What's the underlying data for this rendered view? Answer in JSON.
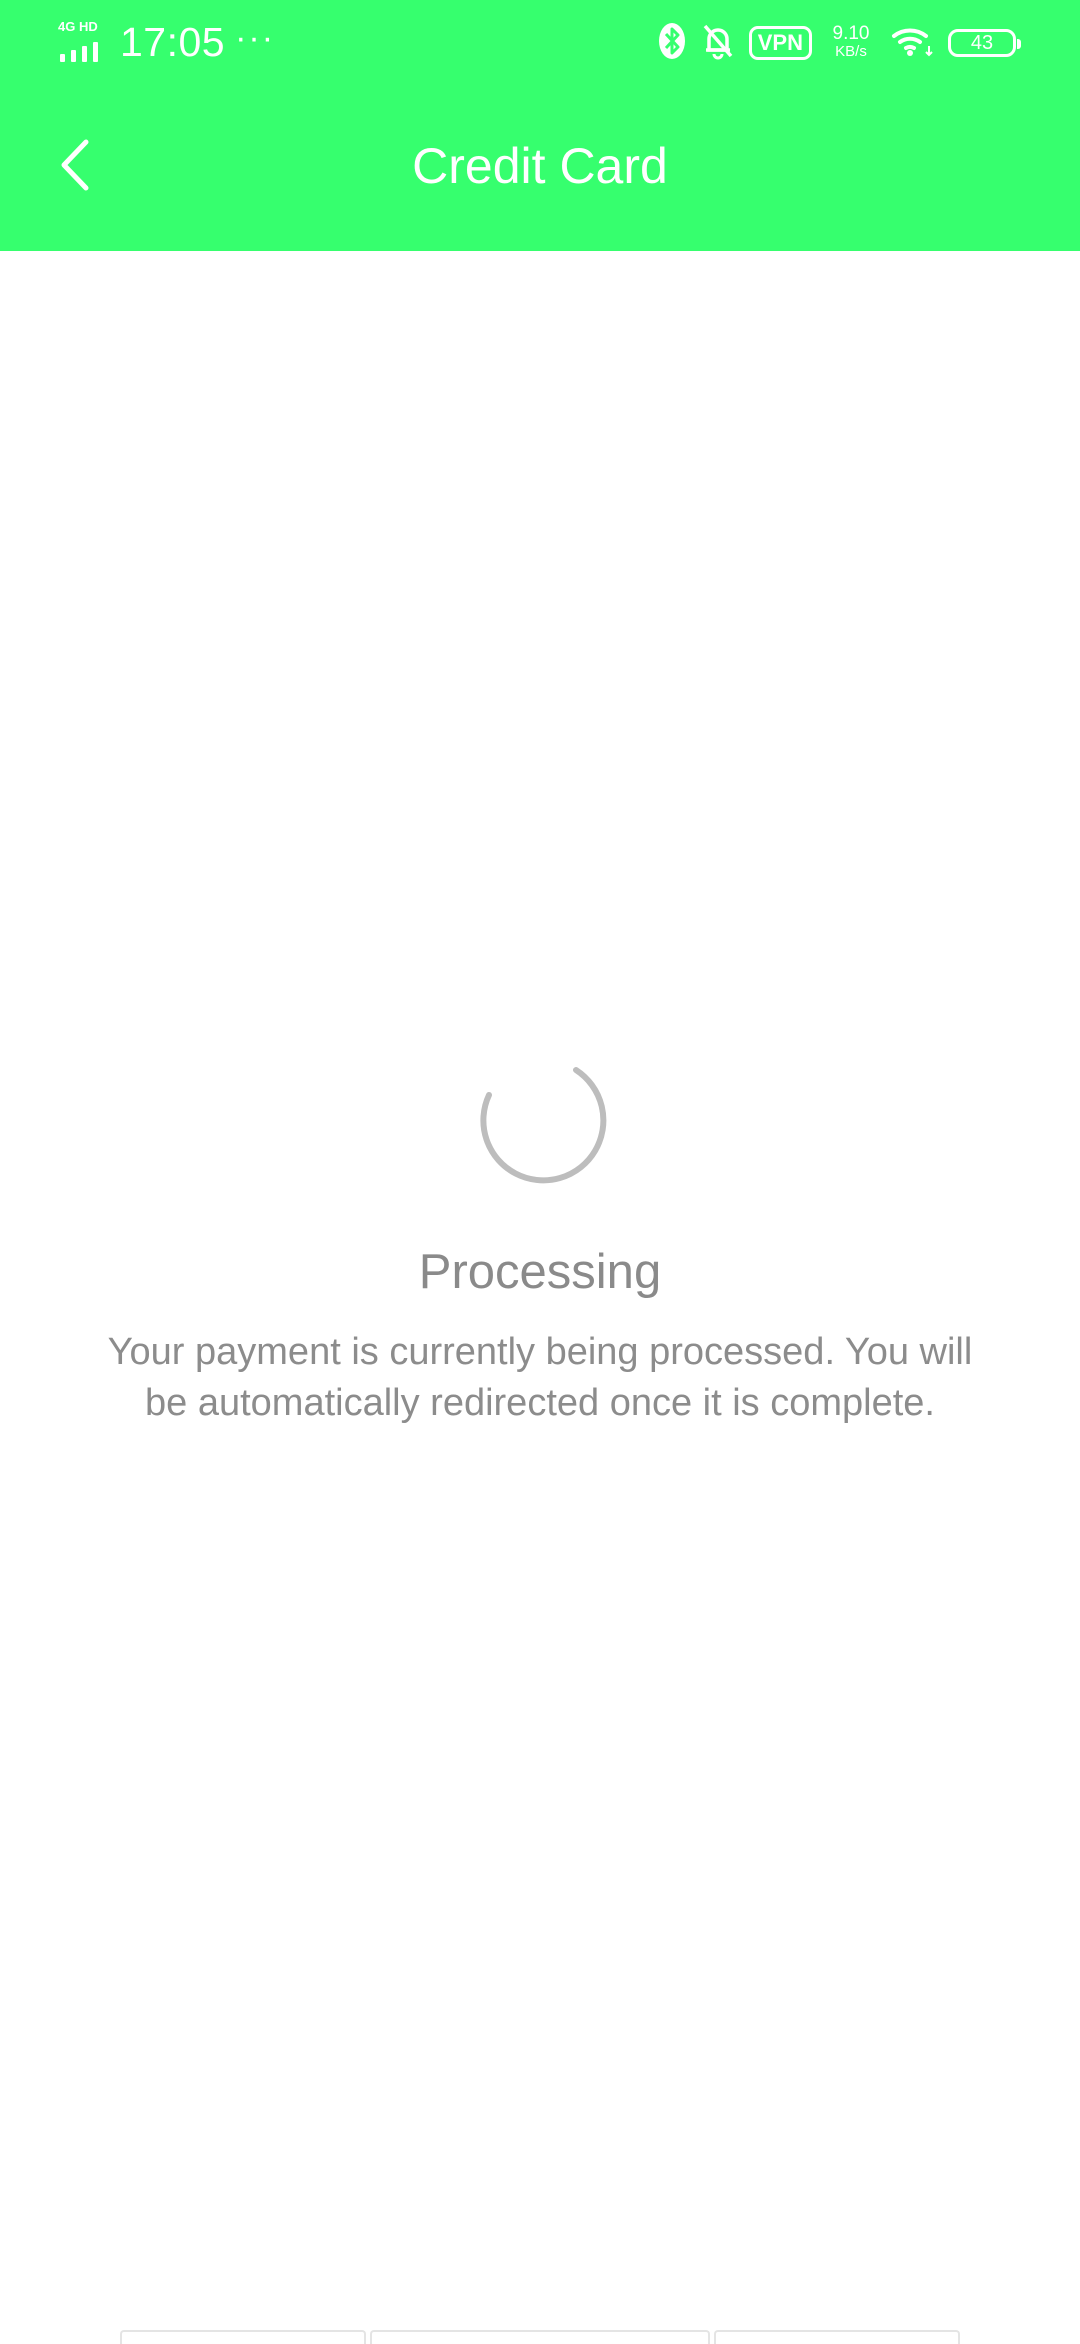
{
  "status_bar": {
    "network_type": "4G HD",
    "time": "17:05",
    "more_indicator": "···",
    "icons": [
      "bluetooth-icon",
      "bell-muted-icon",
      "wifi-icon"
    ],
    "vpn_label": "VPN",
    "speed_value": "9.10",
    "speed_unit": "KB/s",
    "battery_level": "43"
  },
  "header": {
    "title": "Credit Card",
    "back_icon": "chevron-left-icon",
    "background_color": "#36ff6e"
  },
  "main": {
    "status_title": "Processing",
    "status_message": "Your payment is currently being processed. You will be automatically redirected once it is complete.",
    "spinner_icon": "loading-spinner-icon"
  }
}
